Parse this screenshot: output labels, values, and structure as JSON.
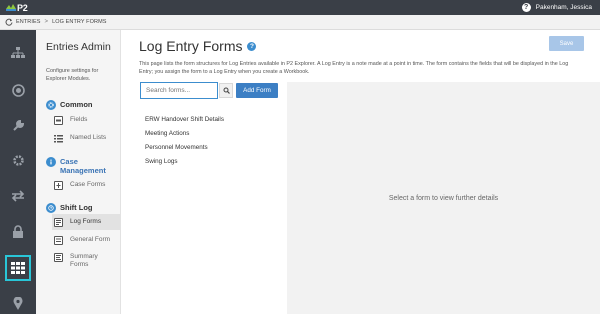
{
  "app": {
    "logo_text": "P2",
    "user_name": "Pakenham, Jessica",
    "help_glyph": "?"
  },
  "breadcrumb": {
    "items": [
      "ENTRIES",
      "LOG ENTRY FORMS"
    ],
    "separator": ">"
  },
  "rail": {
    "icons": [
      "network-icon",
      "globe-icon",
      "wrench-icon",
      "gear-icon",
      "transfer-icon",
      "lock-icon",
      "grid-icon",
      "map-pin-icon"
    ],
    "active_index": 6,
    "accent": "#29c6d8"
  },
  "sidebar": {
    "title": "Entries Admin",
    "subtitle": "Configure settings for Explorer Modules.",
    "groups": [
      {
        "label": "Common",
        "items": [
          {
            "label": "Fields"
          },
          {
            "label": "Named Lists"
          }
        ]
      },
      {
        "label": "Case Management",
        "items": [
          {
            "label": "Case Forms"
          }
        ]
      },
      {
        "label": "Shift Log",
        "items": [
          {
            "label": "Log Forms"
          },
          {
            "label": "General Form"
          },
          {
            "label": "Summary Forms"
          }
        ]
      }
    ]
  },
  "main": {
    "title": "Log Entry Forms",
    "info_glyph": "?",
    "save_label": "Save",
    "description_line1": "This page lists the form structures for Log Entries available in P2 Explorer. A Log Entry is a note made at a point in time. The form contains the fields that will be displayed in the Log",
    "description_line2": "Entry; you assign the form to a Log Entry when you create a Workbook.",
    "search_placeholder": "Search forms...",
    "add_label": "Add Form",
    "forms": [
      "ERW Handover Shift Details",
      "Meeting Actions",
      "Personnel Movements",
      "Swing Logs"
    ],
    "empty_detail": "Select a form to view further details"
  },
  "colors": {
    "topbar": "#3a3f47",
    "primary": "#3c7fc4",
    "save_disabled": "#a8c6e8"
  }
}
